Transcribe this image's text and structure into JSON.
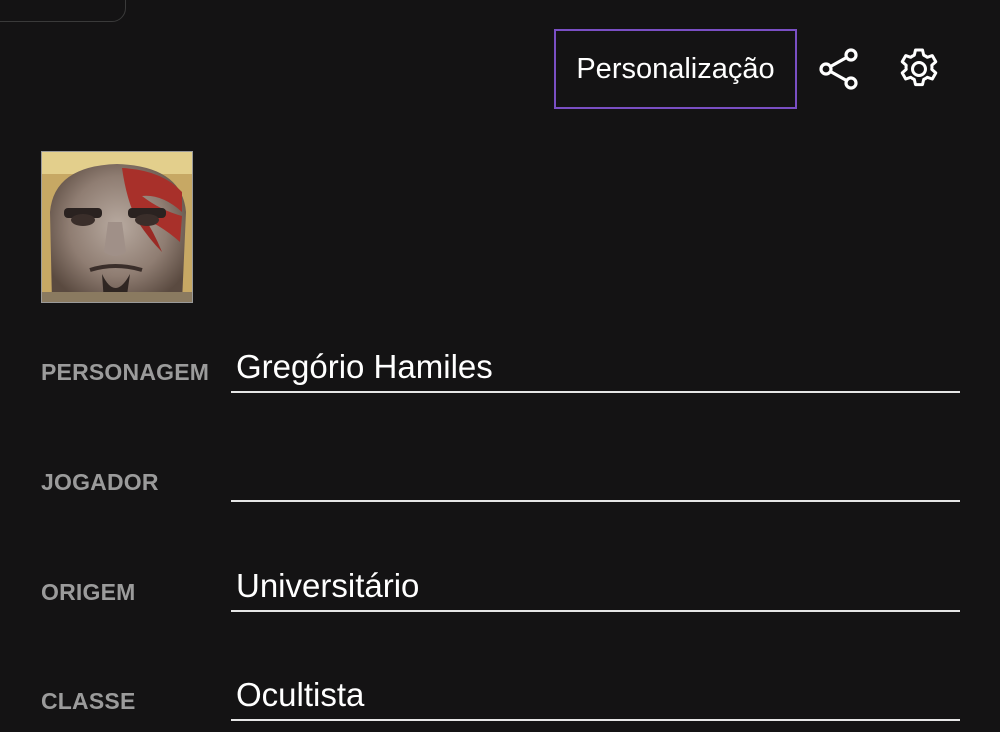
{
  "toolbar": {
    "personalize_label": "Personalização",
    "share_icon": "share-icon",
    "settings_icon": "gear-icon"
  },
  "avatar": {
    "description_icon": "character-portrait"
  },
  "fields": [
    {
      "label": "PERSONAGEM",
      "value": "Gregório Hamiles"
    },
    {
      "label": "JOGADOR",
      "value": ""
    },
    {
      "label": "ORIGEM",
      "value": "Universitário"
    },
    {
      "label": "CLASSE",
      "value": "Ocultista"
    }
  ],
  "colors": {
    "background": "#141314",
    "accent_border": "#7a4fc4",
    "label": "#9b9b9b",
    "underline": "#e6e6e6"
  }
}
